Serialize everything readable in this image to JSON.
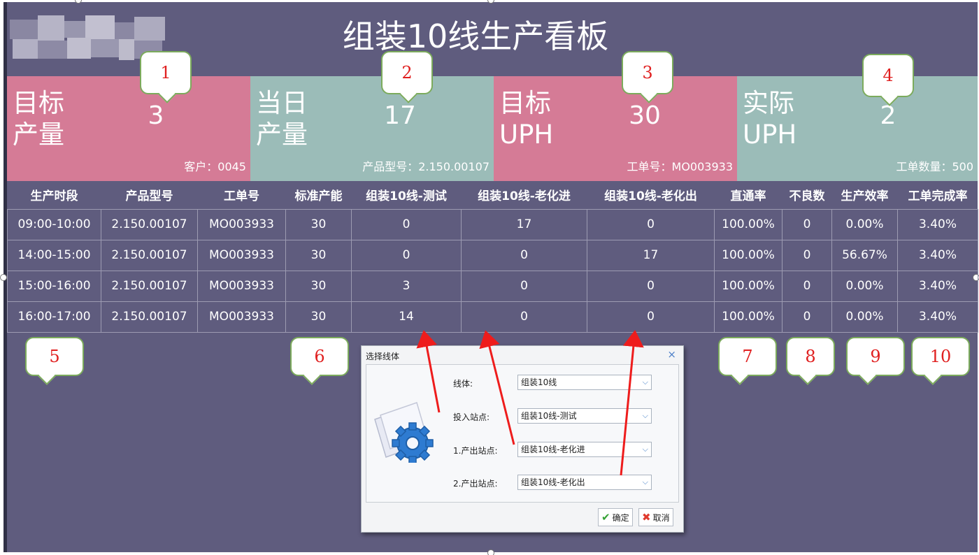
{
  "title": "组装10线生产看板",
  "kpis": [
    {
      "label": [
        "目标",
        "产量"
      ],
      "value": "3",
      "footer": "客户：0045",
      "color": "#d57b96"
    },
    {
      "label": [
        "当日",
        "产量"
      ],
      "value": "17",
      "footer": "产品型号：2.150.00107",
      "color": "#9bbcb8"
    },
    {
      "label": [
        "目标",
        "UPH"
      ],
      "value": "30",
      "footer": "工单号：MO003933",
      "color": "#d57b96"
    },
    {
      "label": [
        "实际",
        "UPH"
      ],
      "value": "2",
      "footer": "工单数量：500",
      "color": "#9bbcb8"
    }
  ],
  "callouts": [
    "1",
    "2",
    "3",
    "4",
    "5",
    "6",
    "7",
    "8",
    "9",
    "10"
  ],
  "table": {
    "headers": [
      "生产时段",
      "产品型号",
      "工单号",
      "标准产能",
      "组装10线-测试",
      "组装10线-老化进",
      "组装10线-老化出",
      "直通率",
      "不良数",
      "生产效率",
      "工单完成率"
    ],
    "rows": [
      [
        "09:00-10:00",
        "2.150.00107",
        "MO003933",
        "30",
        "0",
        "17",
        "0",
        "100.00%",
        "0",
        "0.00%",
        "3.40%"
      ],
      [
        "14:00-15:00",
        "2.150.00107",
        "MO003933",
        "30",
        "0",
        "0",
        "17",
        "100.00%",
        "0",
        "56.67%",
        "3.40%"
      ],
      [
        "15:00-16:00",
        "2.150.00107",
        "MO003933",
        "30",
        "3",
        "0",
        "0",
        "100.00%",
        "0",
        "0.00%",
        "3.40%"
      ],
      [
        "16:00-17:00",
        "2.150.00107",
        "MO003933",
        "30",
        "14",
        "0",
        "0",
        "100.00%",
        "0",
        "0.00%",
        "3.40%"
      ]
    ]
  },
  "dialog": {
    "title": "选择线体",
    "close": "×",
    "fields": [
      {
        "label": "线体:",
        "value": "组装10线"
      },
      {
        "label": "投入站点:",
        "value": "组装10线-测试"
      },
      {
        "label": "1.产出站点:",
        "value": "组装10线-老化进"
      },
      {
        "label": "2.产出站点:",
        "value": "组装10线-老化出"
      }
    ],
    "ok_label": "确定",
    "cancel_label": "取消",
    "dropdown_icon": "chevron-down-icon",
    "settings_icon": "gear-icon"
  },
  "colors": {
    "background": "#5f5c7e",
    "kpi_pink": "#d57b96",
    "kpi_teal": "#9bbcb8",
    "callout_border": "#7cab5c",
    "callout_text": "#e02020",
    "arrow": "#ee1c1c"
  }
}
